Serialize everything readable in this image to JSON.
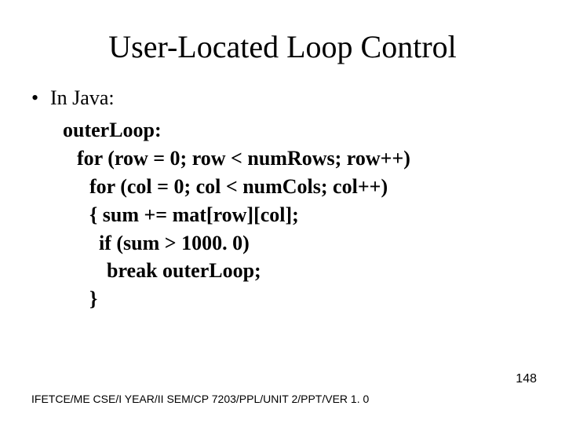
{
  "title": "User-Located Loop Control",
  "bullet1": "In Java:",
  "code": {
    "l0": "outerLoop:",
    "l1": "for (row = 0; row < numRows; row++)",
    "l2": "for (col = 0; col < numCols; col++)",
    "l3": "{ sum += mat[row][col];",
    "l4": "if (sum > 1000. 0)",
    "l5": "break outerLoop;",
    "l6": "}"
  },
  "footer": "IFETCE/ME CSE/I YEAR/II SEM/CP 7203/PPL/UNIT 2/PPT/VER 1. 0",
  "page_number": "148"
}
